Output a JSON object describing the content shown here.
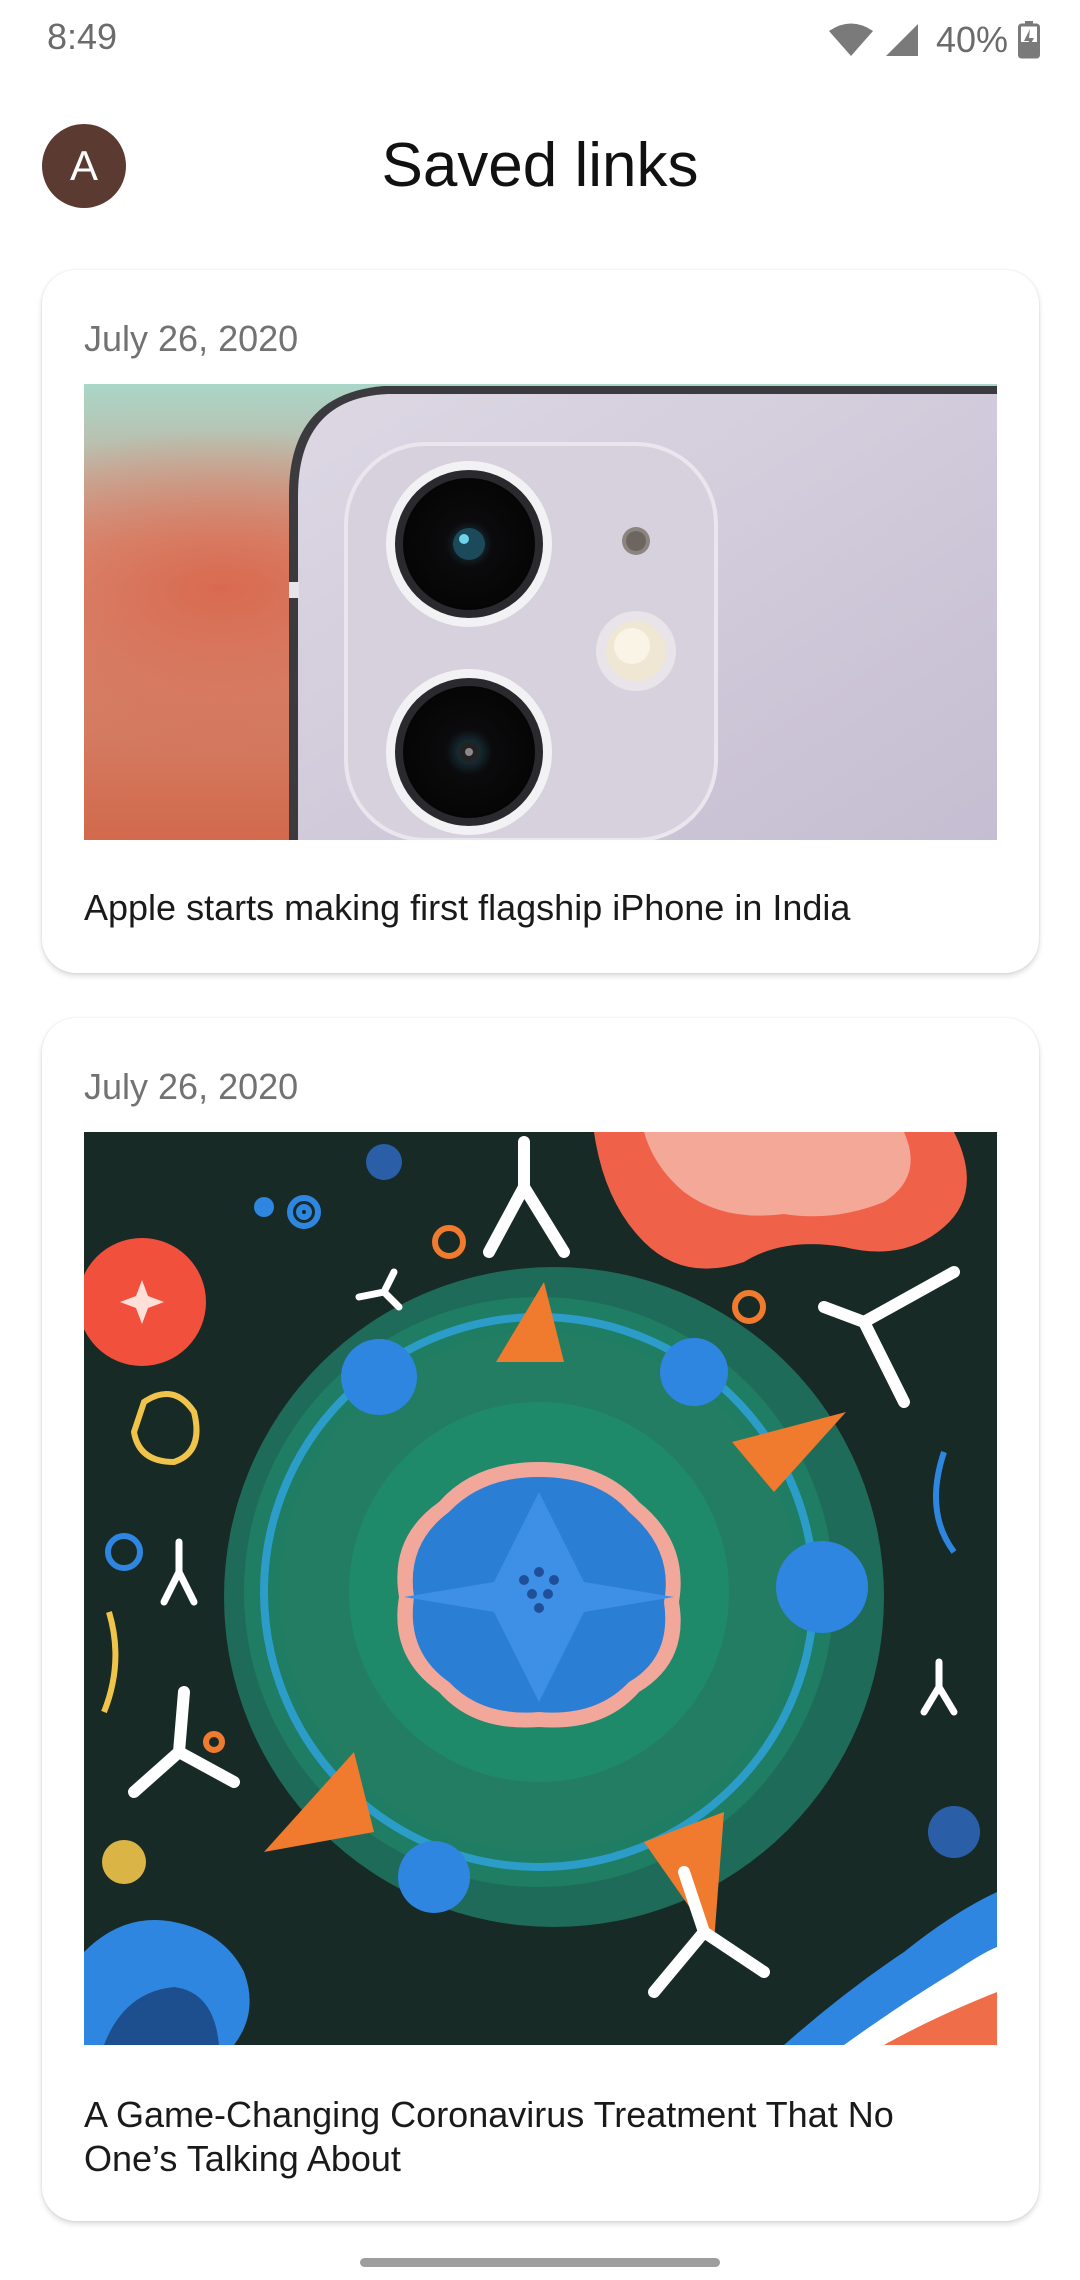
{
  "status_bar": {
    "time": "8:49",
    "battery_percent": "40%",
    "icons": [
      "wifi-icon",
      "cell-signal-icon",
      "battery-charging-icon"
    ]
  },
  "header": {
    "avatar_initial": "A",
    "avatar_color": "#5b3a32",
    "title": "Saved links"
  },
  "links": [
    {
      "date": "July 26, 2020",
      "image": "iphone-dual-camera-photo",
      "headline": "Apple starts making first flagship iPhone in India"
    },
    {
      "date": "July 26, 2020",
      "image": "coronavirus-antibody-illustration",
      "headline": "A Game-Changing Coronavirus Treatment That No One’s Talking About"
    }
  ]
}
